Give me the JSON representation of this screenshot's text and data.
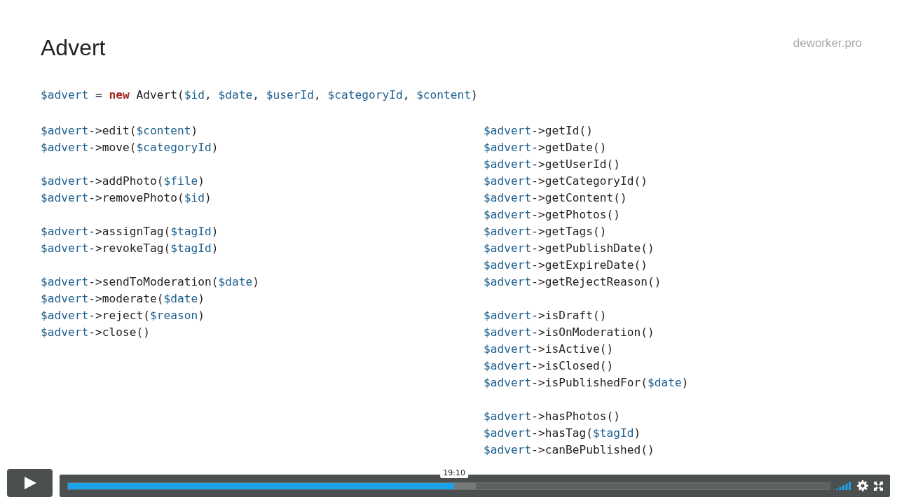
{
  "slide": {
    "title": "Advert",
    "brand": "deworker.pro",
    "constructor": [
      {
        "kind": "var",
        "text": "$advert"
      },
      {
        "kind": "plain",
        "text": " = "
      },
      {
        "kind": "keyword",
        "text": "new"
      },
      {
        "kind": "plain",
        "text": " Advert("
      },
      {
        "kind": "var",
        "text": "$id"
      },
      {
        "kind": "plain",
        "text": ", "
      },
      {
        "kind": "var",
        "text": "$date"
      },
      {
        "kind": "plain",
        "text": ", "
      },
      {
        "kind": "var",
        "text": "$userId"
      },
      {
        "kind": "plain",
        "text": ", "
      },
      {
        "kind": "var",
        "text": "$categoryId"
      },
      {
        "kind": "plain",
        "text": ", "
      },
      {
        "kind": "var",
        "text": "$content"
      },
      {
        "kind": "plain",
        "text": ")"
      }
    ],
    "left_groups": [
      [
        [
          {
            "kind": "var",
            "text": "$advert"
          },
          {
            "kind": "plain",
            "text": "->edit("
          },
          {
            "kind": "var",
            "text": "$content"
          },
          {
            "kind": "plain",
            "text": ")"
          }
        ],
        [
          {
            "kind": "var",
            "text": "$advert"
          },
          {
            "kind": "plain",
            "text": "->move("
          },
          {
            "kind": "var",
            "text": "$categoryId"
          },
          {
            "kind": "plain",
            "text": ")"
          }
        ]
      ],
      [
        [
          {
            "kind": "var",
            "text": "$advert"
          },
          {
            "kind": "plain",
            "text": "->addPhoto("
          },
          {
            "kind": "var",
            "text": "$file"
          },
          {
            "kind": "plain",
            "text": ")"
          }
        ],
        [
          {
            "kind": "var",
            "text": "$advert"
          },
          {
            "kind": "plain",
            "text": "->removePhoto("
          },
          {
            "kind": "var",
            "text": "$id"
          },
          {
            "kind": "plain",
            "text": ")"
          }
        ]
      ],
      [
        [
          {
            "kind": "var",
            "text": "$advert"
          },
          {
            "kind": "plain",
            "text": "->assignTag("
          },
          {
            "kind": "var",
            "text": "$tagId"
          },
          {
            "kind": "plain",
            "text": ")"
          }
        ],
        [
          {
            "kind": "var",
            "text": "$advert"
          },
          {
            "kind": "plain",
            "text": "->revokeTag("
          },
          {
            "kind": "var",
            "text": "$tagId"
          },
          {
            "kind": "plain",
            "text": ")"
          }
        ]
      ],
      [
        [
          {
            "kind": "var",
            "text": "$advert"
          },
          {
            "kind": "plain",
            "text": "->sendToModeration("
          },
          {
            "kind": "var",
            "text": "$date"
          },
          {
            "kind": "plain",
            "text": ")"
          }
        ],
        [
          {
            "kind": "var",
            "text": "$advert"
          },
          {
            "kind": "plain",
            "text": "->moderate("
          },
          {
            "kind": "var",
            "text": "$date"
          },
          {
            "kind": "plain",
            "text": ")"
          }
        ],
        [
          {
            "kind": "var",
            "text": "$advert"
          },
          {
            "kind": "plain",
            "text": "->reject("
          },
          {
            "kind": "var",
            "text": "$reason"
          },
          {
            "kind": "plain",
            "text": ")"
          }
        ],
        [
          {
            "kind": "var",
            "text": "$advert"
          },
          {
            "kind": "plain",
            "text": "->close()"
          }
        ]
      ]
    ],
    "right_groups": [
      [
        [
          {
            "kind": "var",
            "text": "$advert"
          },
          {
            "kind": "plain",
            "text": "->getId()"
          }
        ],
        [
          {
            "kind": "var",
            "text": "$advert"
          },
          {
            "kind": "plain",
            "text": "->getDate()"
          }
        ],
        [
          {
            "kind": "var",
            "text": "$advert"
          },
          {
            "kind": "plain",
            "text": "->getUserId()"
          }
        ],
        [
          {
            "kind": "var",
            "text": "$advert"
          },
          {
            "kind": "plain",
            "text": "->getCategoryId()"
          }
        ],
        [
          {
            "kind": "var",
            "text": "$advert"
          },
          {
            "kind": "plain",
            "text": "->getContent()"
          }
        ],
        [
          {
            "kind": "var",
            "text": "$advert"
          },
          {
            "kind": "plain",
            "text": "->getPhotos()"
          }
        ],
        [
          {
            "kind": "var",
            "text": "$advert"
          },
          {
            "kind": "plain",
            "text": "->getTags()"
          }
        ],
        [
          {
            "kind": "var",
            "text": "$advert"
          },
          {
            "kind": "plain",
            "text": "->getPublishDate()"
          }
        ],
        [
          {
            "kind": "var",
            "text": "$advert"
          },
          {
            "kind": "plain",
            "text": "->getExpireDate()"
          }
        ],
        [
          {
            "kind": "var",
            "text": "$advert"
          },
          {
            "kind": "plain",
            "text": "->getRejectReason()"
          }
        ]
      ],
      [
        [
          {
            "kind": "var",
            "text": "$advert"
          },
          {
            "kind": "plain",
            "text": "->isDraft()"
          }
        ],
        [
          {
            "kind": "var",
            "text": "$advert"
          },
          {
            "kind": "plain",
            "text": "->isOnModeration()"
          }
        ],
        [
          {
            "kind": "var",
            "text": "$advert"
          },
          {
            "kind": "plain",
            "text": "->isActive()"
          }
        ],
        [
          {
            "kind": "var",
            "text": "$advert"
          },
          {
            "kind": "plain",
            "text": "->isClosed()"
          }
        ],
        [
          {
            "kind": "var",
            "text": "$advert"
          },
          {
            "kind": "plain",
            "text": "->isPublishedFor("
          },
          {
            "kind": "var",
            "text": "$date"
          },
          {
            "kind": "plain",
            "text": ")"
          }
        ]
      ],
      [
        [
          {
            "kind": "var",
            "text": "$advert"
          },
          {
            "kind": "plain",
            "text": "->hasPhotos()"
          }
        ],
        [
          {
            "kind": "var",
            "text": "$advert"
          },
          {
            "kind": "plain",
            "text": "->hasTag("
          },
          {
            "kind": "var",
            "text": "$tagId"
          },
          {
            "kind": "plain",
            "text": ")"
          }
        ],
        [
          {
            "kind": "var",
            "text": "$advert"
          },
          {
            "kind": "plain",
            "text": "->canBePublished()"
          }
        ]
      ]
    ]
  },
  "player": {
    "time_tooltip": "19:10",
    "progress": {
      "level": 0.507
    },
    "buffered": {
      "level": 0.535
    }
  }
}
